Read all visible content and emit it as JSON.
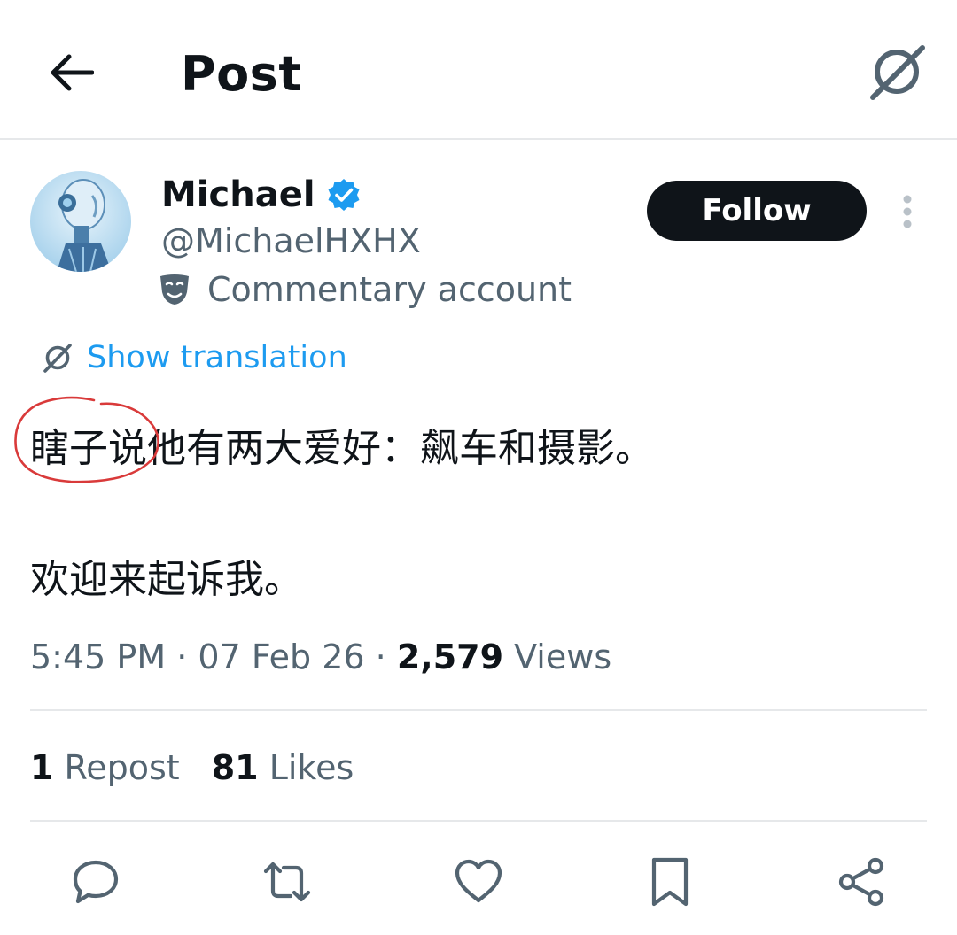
{
  "header": {
    "title": "Post",
    "back_icon": "arrow-left-icon",
    "translate_icon": "translate-icon"
  },
  "author": {
    "display_name": "Michael",
    "handle": "@MichaelHXHX",
    "verified": true,
    "label": "Commentary account",
    "label_icon": "theater-mask-icon",
    "avatar_icon": "robot-avatar"
  },
  "follow_button": {
    "label": "Follow"
  },
  "translation": {
    "label": "Show translation"
  },
  "post": {
    "lines": [
      "瞎子说他有两大爱好：飙车和摄影。",
      "欢迎来起诉我。"
    ]
  },
  "meta": {
    "time": "5:45 PM",
    "date": "07 Feb 26",
    "views_count": "2,579",
    "views_label": "Views",
    "separator": "·"
  },
  "stats": {
    "reposts_count": "1",
    "reposts_label": "Repost",
    "likes_count": "81",
    "likes_label": "Likes"
  },
  "actions": [
    "reply-icon",
    "repost-icon",
    "like-icon",
    "bookmark-icon",
    "share-icon"
  ],
  "colors": {
    "text": "#0f1419",
    "secondary": "#536471",
    "link": "#1d9bf0",
    "verified": "#1d9bf0",
    "annotation": "#d93a3a"
  }
}
